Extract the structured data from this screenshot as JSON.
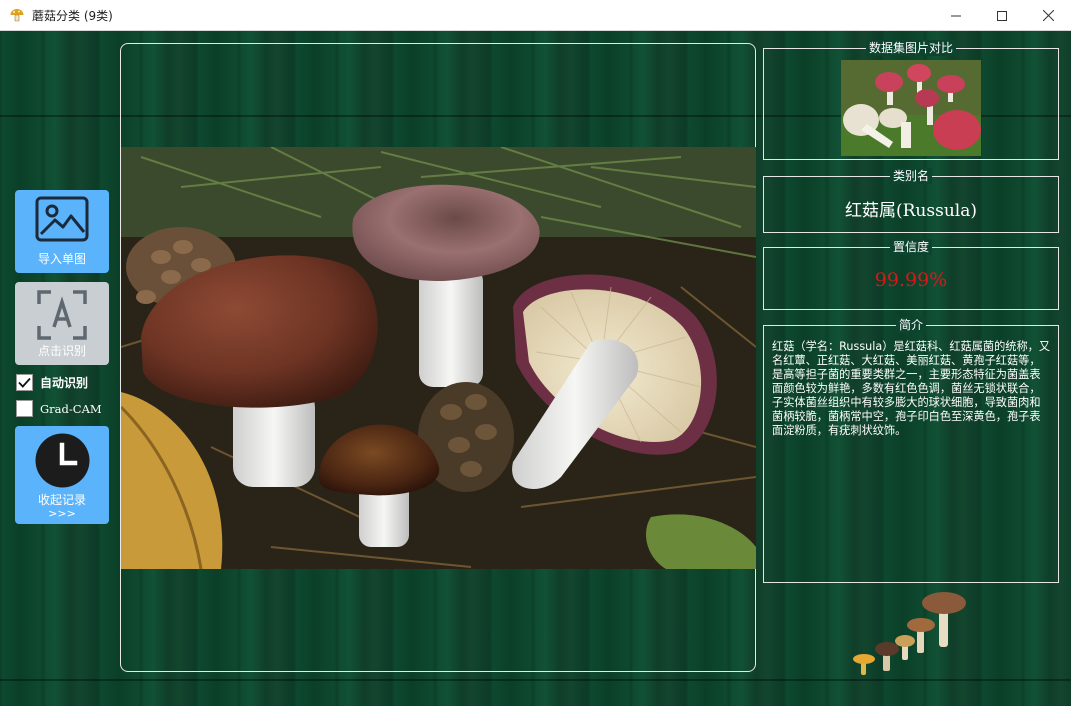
{
  "window": {
    "title": "蘑菇分类 (9类)",
    "app_icon": "mushroom-icon",
    "controls": [
      "minimize-icon",
      "maximize-icon",
      "close-icon"
    ]
  },
  "toolbar": {
    "import_label": "导入单图",
    "recognize_label": "点击识别",
    "auto_recognize_label": "自动识别",
    "auto_recognize_checked": true,
    "gradcam_label": "Grad-CAM",
    "gradcam_checked": false,
    "history_label": "收起记录",
    "history_arrow": ">>>"
  },
  "panels": {
    "compare": {
      "title": "数据集图片对比"
    },
    "class": {
      "title": "类别名",
      "value": "红菇属(Russula)"
    },
    "confidence": {
      "title": "置信度",
      "value": "99.99%"
    },
    "intro": {
      "title": "简介",
      "text": "红菇（学名：Russula）是红菇科、红菇属菌的统称，又名红蕈、正红菇、大红菇、美丽红菇、黄孢子红菇等，是高等担子菌的重要类群之一，主要形态特征为菌盖表面颜色较为鲜艳，多数有红色色调，菌丝无锁状联合，子实体菌丝组织中有较多膨大的球状细胞，导致菌肉和菌柄较脆，菌柄常中空，孢子印白色至深黄色，孢子表面淀粉质，有疣刺状纹饰。"
    }
  },
  "colors": {
    "accent_blue": "#5bb4fb",
    "disabled_grey": "#c9ced3",
    "confidence_red": "#d91818",
    "background_green": "#0c3d27"
  }
}
